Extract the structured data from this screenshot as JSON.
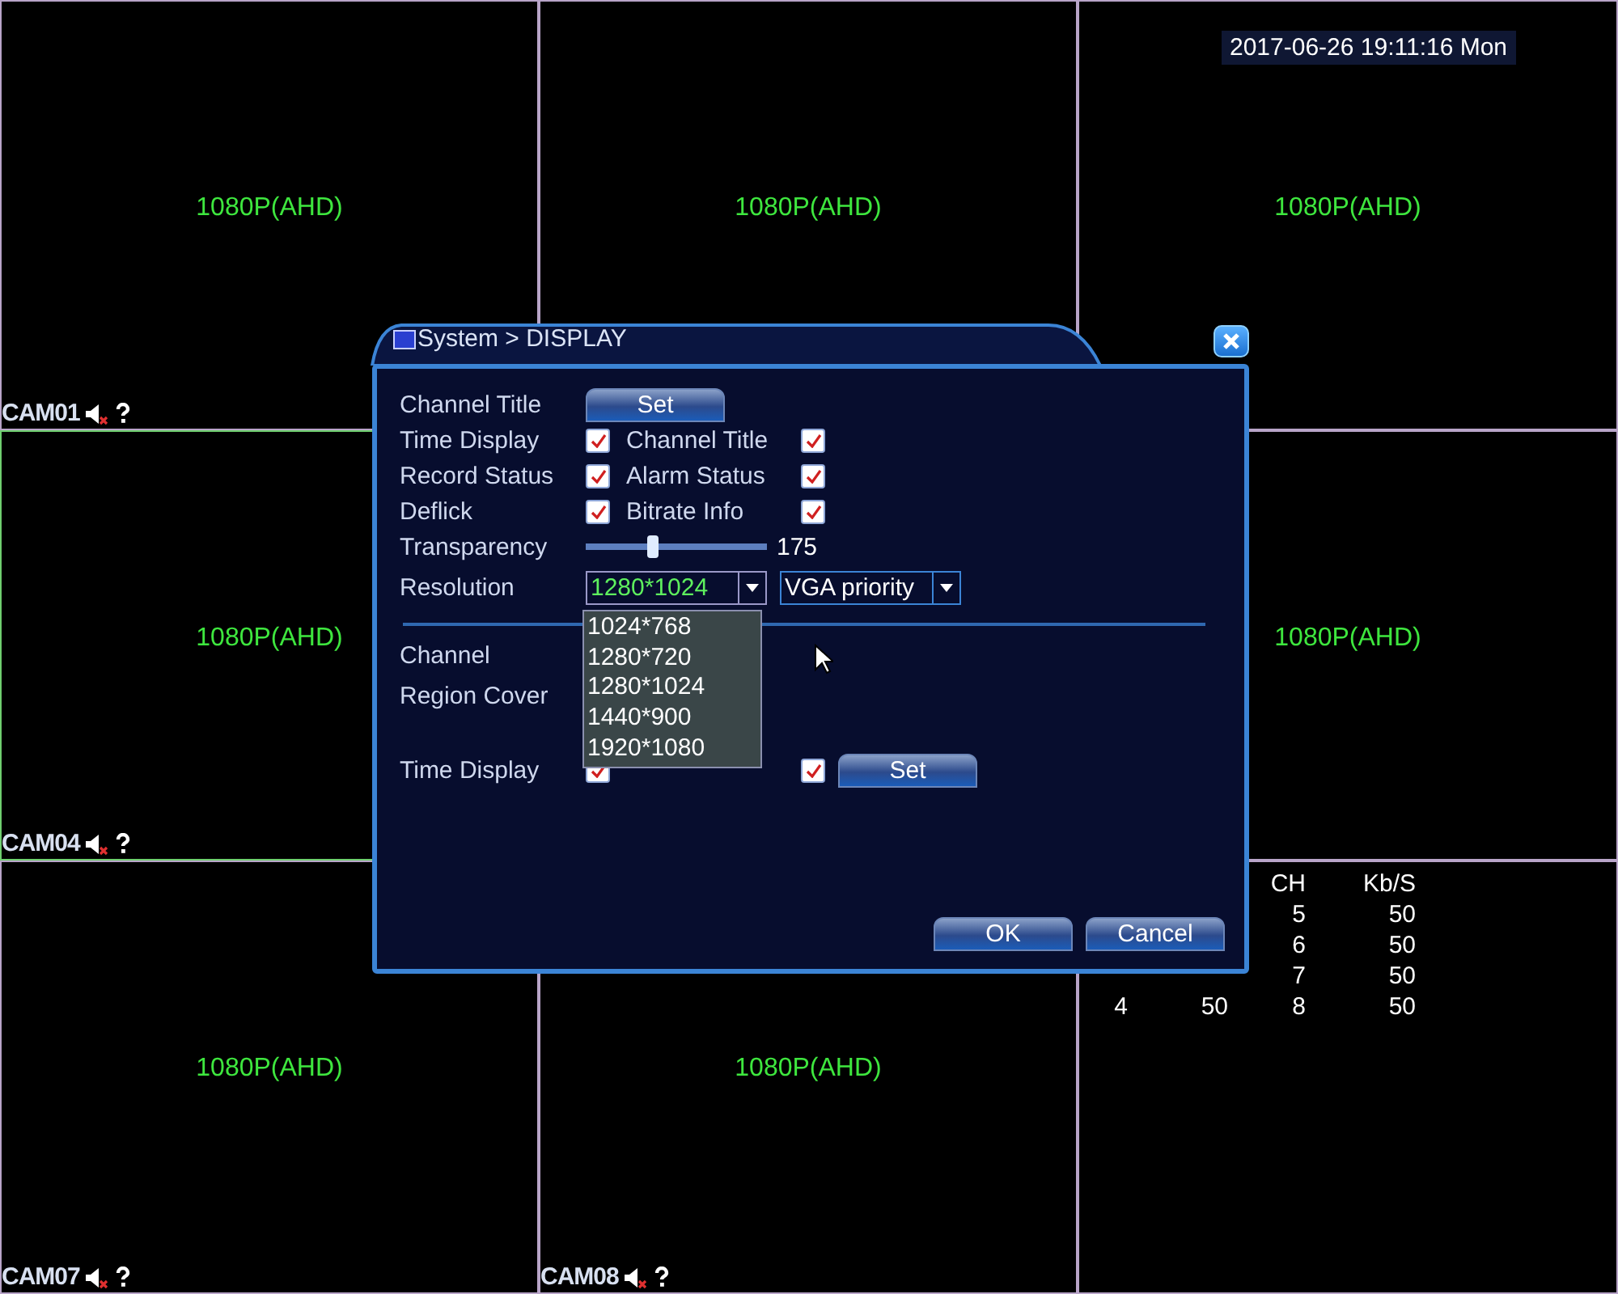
{
  "datetime": "2017-06-26 19:11:16 Mon",
  "tiles": [
    {
      "resolution": "1080P(AHD)",
      "label": "CAM01",
      "selected": false
    },
    {
      "resolution": "1080P(AHD)",
      "selected": false
    },
    {
      "resolution": "1080P(AHD)",
      "selected": false
    },
    {
      "resolution": "1080P(AHD)",
      "label": "CAM04",
      "selected": true
    },
    {
      "resolution": "1080P(AHD)",
      "selected": false
    },
    {
      "resolution": "1080P(AHD)",
      "label": "CAM07",
      "selected": false
    },
    {
      "resolution": "1080P(AHD)",
      "label": "CAM08",
      "selected": false
    },
    {
      "selected": false
    }
  ],
  "bitrate": {
    "columns": [
      "",
      "",
      "CH",
      "Kb/S"
    ],
    "rows": [
      [
        "",
        "",
        "5",
        "50"
      ],
      [
        "",
        "",
        "6",
        "50"
      ],
      [
        "",
        "",
        "7",
        "50"
      ],
      [
        "4",
        "50",
        "8",
        "50"
      ]
    ]
  },
  "dialog": {
    "title": "System > DISPLAY",
    "channel_title_label": "Channel Title",
    "set_button": "Set",
    "options": [
      {
        "label": "Time Display",
        "checked": true,
        "label2": "Channel Title",
        "checked2": true
      },
      {
        "label": "Record Status",
        "checked": true,
        "label2": "Alarm Status",
        "checked2": true
      },
      {
        "label": "Deflick",
        "checked": true,
        "label2": "Bitrate Info",
        "checked2": true
      }
    ],
    "transparency": {
      "label": "Transparency",
      "level": 0.37,
      "reading": "175"
    },
    "resolution": {
      "label": "Resolution",
      "value": "1280*1024",
      "mode": "VGA priority",
      "options": [
        "1024*768",
        "1280*720",
        "1280*1024",
        "1440*900",
        "1920*1080"
      ]
    },
    "channel_label": "Channel",
    "region_cover_label": "Region Cover",
    "bottom": {
      "label": "Time Display",
      "checked": true,
      "checked2": true,
      "button": "Set"
    },
    "buttons": [
      "OK",
      "Cancel"
    ]
  }
}
